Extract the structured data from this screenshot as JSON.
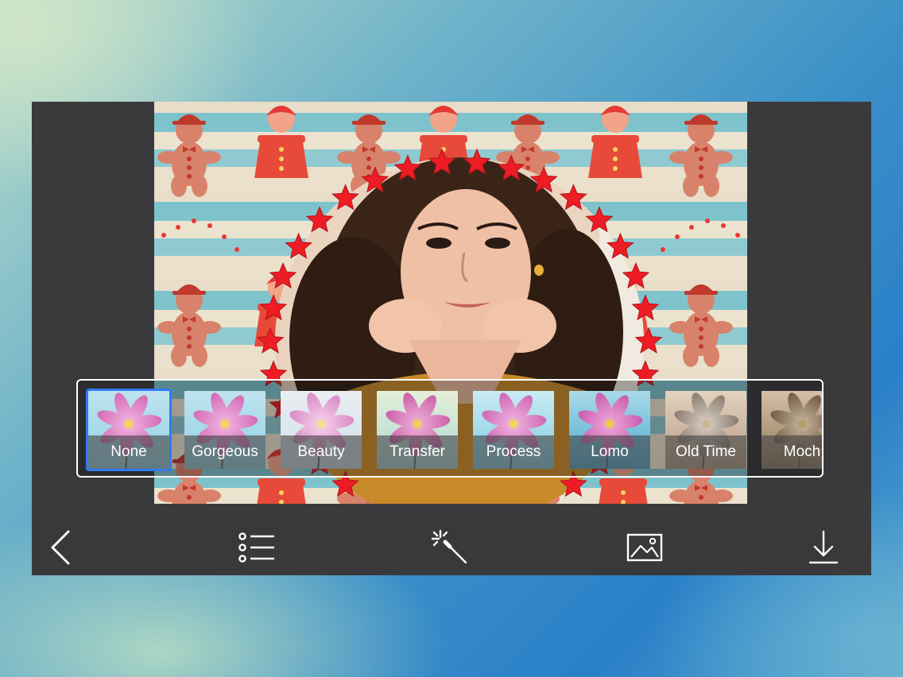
{
  "filters": {
    "selected_index": 0,
    "items": [
      {
        "label": "None",
        "tone": "normal"
      },
      {
        "label": "Gorgeous",
        "tone": "normal"
      },
      {
        "label": "Beauty",
        "tone": "soft"
      },
      {
        "label": "Transfer",
        "tone": "warm"
      },
      {
        "label": "Process",
        "tone": "cool"
      },
      {
        "label": "Lomo",
        "tone": "lomo"
      },
      {
        "label": "Old Time",
        "tone": "sepia"
      },
      {
        "label": "Moch",
        "tone": "mocha"
      }
    ]
  },
  "toolbar": {
    "back": {
      "icon": "chevron-left-icon"
    },
    "list": {
      "icon": "list-icon"
    },
    "effects": {
      "icon": "magic-wand-icon"
    },
    "gallery": {
      "icon": "image-icon"
    },
    "save": {
      "icon": "download-icon"
    }
  },
  "colors": {
    "selection": "#2f7bf2",
    "panel": "#3a3a3c",
    "star": "#ee1c24"
  }
}
